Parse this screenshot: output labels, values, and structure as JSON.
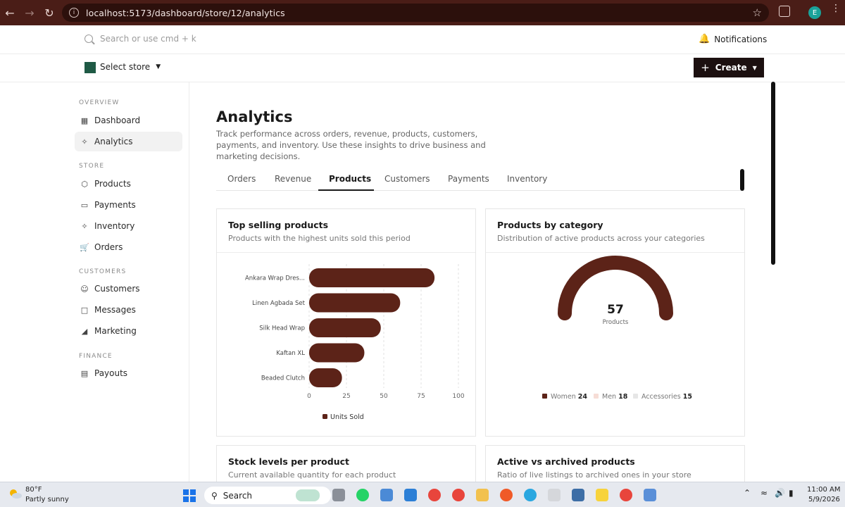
{
  "browser": {
    "url": "localhost:5173/dashboard/store/12/analytics",
    "profile_initial": "E",
    "info_glyph": "i"
  },
  "header": {
    "search_placeholder": "Search or use cmd + k",
    "notifications_label": "Notifications",
    "store_select_label": "Select store",
    "create_label": "Create"
  },
  "sidebar": {
    "sections": [
      {
        "title": "OVERVIEW",
        "items": [
          {
            "label": "Dashboard",
            "icon": "grid-icon"
          },
          {
            "label": "Analytics",
            "icon": "analytics-icon",
            "active": true
          }
        ]
      },
      {
        "title": "STORE",
        "items": [
          {
            "label": "Products",
            "icon": "box-icon"
          },
          {
            "label": "Payments",
            "icon": "card-icon"
          },
          {
            "label": "Inventory",
            "icon": "layers-icon"
          },
          {
            "label": "Orders",
            "icon": "cart-icon"
          }
        ]
      },
      {
        "title": "CUSTOMERS",
        "items": [
          {
            "label": "Customers",
            "icon": "users-icon"
          },
          {
            "label": "Messages",
            "icon": "message-icon"
          },
          {
            "label": "Marketing",
            "icon": "megaphone-icon"
          }
        ]
      },
      {
        "title": "FINANCE",
        "items": [
          {
            "label": "Payouts",
            "icon": "wallet-icon"
          }
        ]
      }
    ]
  },
  "main": {
    "title": "Analytics",
    "description": "Track performance across orders, revenue, products, customers, payments, and inventory. Use these insights to drive business and marketing decisions.",
    "tabs": [
      {
        "label": "Orders"
      },
      {
        "label": "Revenue"
      },
      {
        "label": "Products",
        "active": true
      },
      {
        "label": "Customers"
      },
      {
        "label": "Payments"
      },
      {
        "label": "Inventory"
      }
    ],
    "cards": {
      "top_selling": {
        "title": "Top selling products",
        "subtitle": "Products with the highest units sold this period"
      },
      "by_category": {
        "title": "Products by category",
        "subtitle": "Distribution of active products across your categories",
        "center_value": "57",
        "center_label": "Products"
      },
      "stock_levels": {
        "title": "Stock levels per product",
        "subtitle": "Current available quantity for each product"
      },
      "active_archived": {
        "title": "Active vs archived products",
        "subtitle": "Ratio of live listings to archived ones in your store"
      }
    }
  },
  "chart_data": [
    {
      "type": "bar",
      "orientation": "horizontal",
      "categories": [
        "Ankara Wrap Dres...",
        "Linen Agbada Set",
        "Silk Head Wrap",
        "Kaftan XL",
        "Beaded Clutch"
      ],
      "series": [
        {
          "name": "Units Sold",
          "values": [
            84,
            61,
            48,
            37,
            22
          ]
        }
      ],
      "xlim": [
        0,
        100
      ],
      "x_ticks": [
        "0",
        "25",
        "50",
        "75",
        "100"
      ],
      "grid": "vertical dashed",
      "legend": "bottom",
      "color": "#5c2318"
    },
    {
      "type": "pie",
      "variant": "half-donut",
      "categories": [
        "Women",
        "Men",
        "Accessories"
      ],
      "values": [
        24,
        18,
        15
      ],
      "colors": [
        "#5c2318",
        "#f6ddd6",
        "#e6e6e6"
      ],
      "legend": "bottom"
    }
  ],
  "taskbar": {
    "weather_temp": "80°F",
    "weather_condition": "Partly sunny",
    "search_label": "Search",
    "time": "11:00 AM",
    "date": "5/9/2026"
  }
}
